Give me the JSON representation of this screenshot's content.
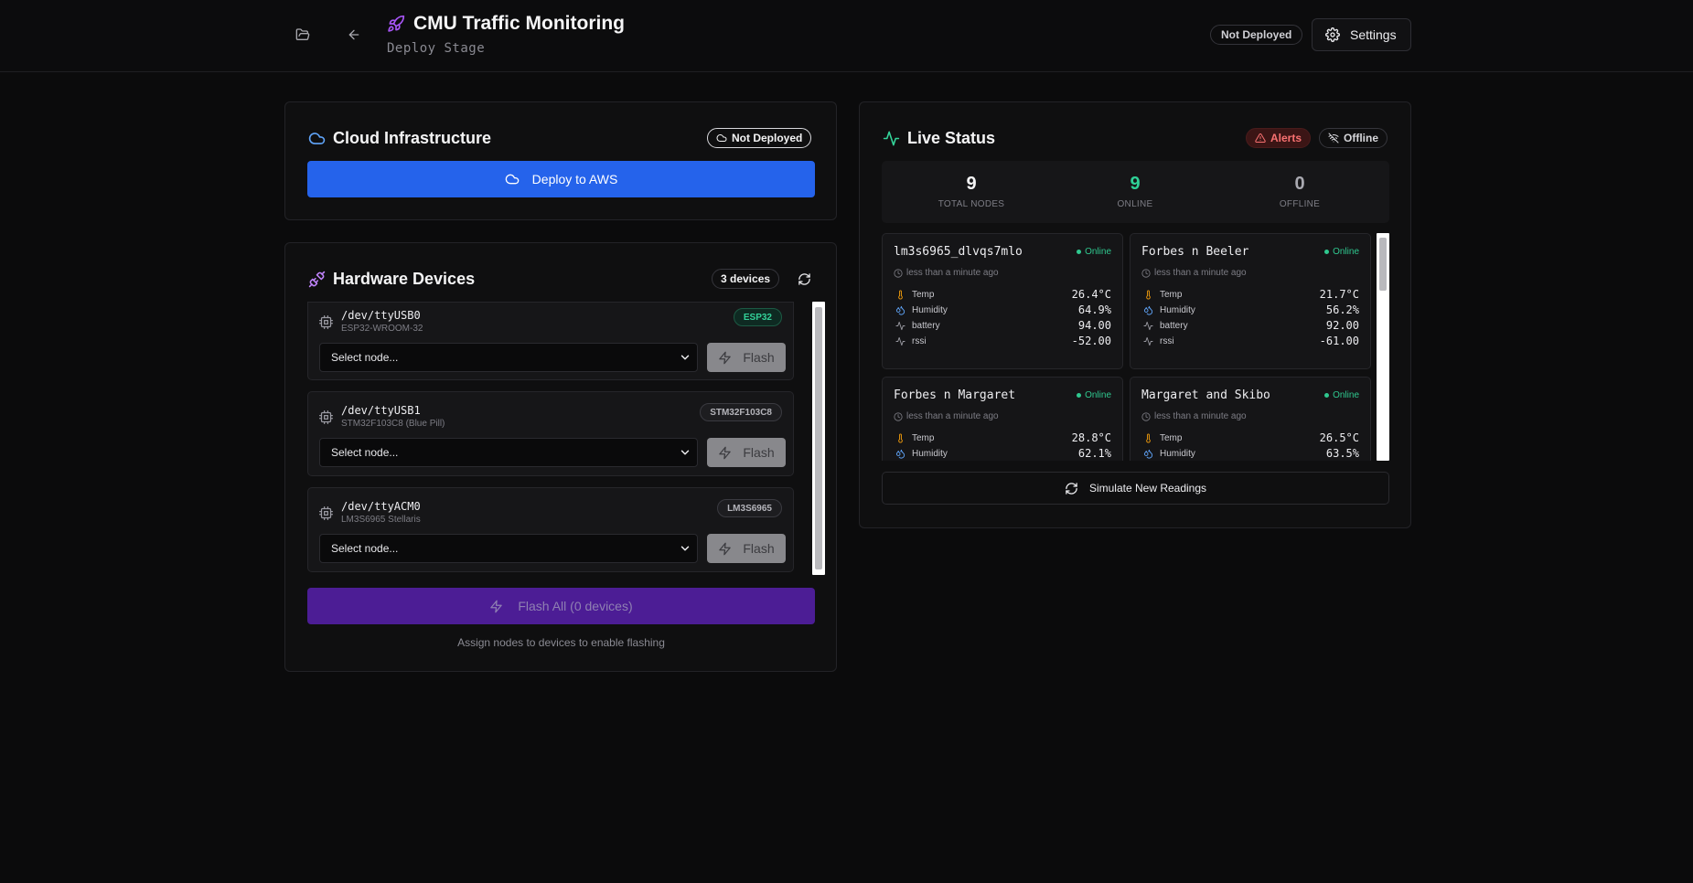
{
  "header": {
    "title": "CMU Traffic Monitoring",
    "subtitle": "Deploy Stage",
    "status_badge": "Not Deployed",
    "settings_label": "Settings",
    "icons": {
      "folder": "folder-open-icon",
      "back": "arrow-left-icon",
      "title": "rocket-icon",
      "settings": "gear-icon"
    }
  },
  "cloud": {
    "title": "Cloud Infrastructure",
    "status": "Not Deployed",
    "deploy_label": "Deploy to AWS",
    "accent": "#2563eb"
  },
  "hardware": {
    "title": "Hardware Devices",
    "count_badge": "3 devices",
    "select_placeholder": "Select node...",
    "flash_label": "Flash",
    "devices": [
      {
        "path": "/dev/ttyUSB0",
        "model": "ESP32-WROOM-32",
        "tag": "ESP32"
      },
      {
        "path": "/dev/ttyUSB1",
        "model": "STM32F103C8 (Blue Pill)",
        "tag": "STM32F103C8"
      },
      {
        "path": "/dev/ttyACM0",
        "model": "LM3S6965 Stellaris",
        "tag": "LM3S6965"
      }
    ],
    "flash_all_label": "Flash All (0 devices)",
    "hint": "Assign nodes to devices to enable flashing",
    "accent": "#4c1d95"
  },
  "live": {
    "title": "Live Status",
    "alerts_label": "Alerts",
    "offline_label": "Offline",
    "stats": [
      {
        "value": "9",
        "label": "TOTAL NODES",
        "color": "#f4f4f5"
      },
      {
        "value": "9",
        "label": "ONLINE",
        "color": "#2fd197"
      },
      {
        "value": "0",
        "label": "OFFLINE",
        "color": "#a9a9b0"
      }
    ],
    "nodes": [
      {
        "name": "lm3s6965_dlvqs7mlo",
        "status": "Online",
        "time": "less than a minute ago",
        "readings": [
          {
            "label": "Temp",
            "value": "26.4°C",
            "icon": "thermometer-icon"
          },
          {
            "label": "Humidity",
            "value": "64.9%",
            "icon": "droplets-icon"
          },
          {
            "label": "battery",
            "value": "94.00",
            "icon": "activity-icon"
          },
          {
            "label": "rssi",
            "value": "-52.00",
            "icon": "activity-icon"
          }
        ]
      },
      {
        "name": "Forbes n Beeler",
        "status": "Online",
        "time": "less than a minute ago",
        "readings": [
          {
            "label": "Temp",
            "value": "21.7°C",
            "icon": "thermometer-icon"
          },
          {
            "label": "Humidity",
            "value": "56.2%",
            "icon": "droplets-icon"
          },
          {
            "label": "battery",
            "value": "92.00",
            "icon": "activity-icon"
          },
          {
            "label": "rssi",
            "value": "-61.00",
            "icon": "activity-icon"
          }
        ]
      },
      {
        "name": "Forbes n Margaret",
        "status": "Online",
        "time": "less than a minute ago",
        "readings": [
          {
            "label": "Temp",
            "value": "28.8°C",
            "icon": "thermometer-icon"
          },
          {
            "label": "Humidity",
            "value": "62.1%",
            "icon": "droplets-icon"
          }
        ]
      },
      {
        "name": "Margaret and Skibo",
        "status": "Online",
        "time": "less than a minute ago",
        "readings": [
          {
            "label": "Temp",
            "value": "26.5°C",
            "icon": "thermometer-icon"
          },
          {
            "label": "Humidity",
            "value": "63.5%",
            "icon": "droplets-icon"
          }
        ]
      }
    ],
    "simulate_label": "Simulate New Readings"
  }
}
